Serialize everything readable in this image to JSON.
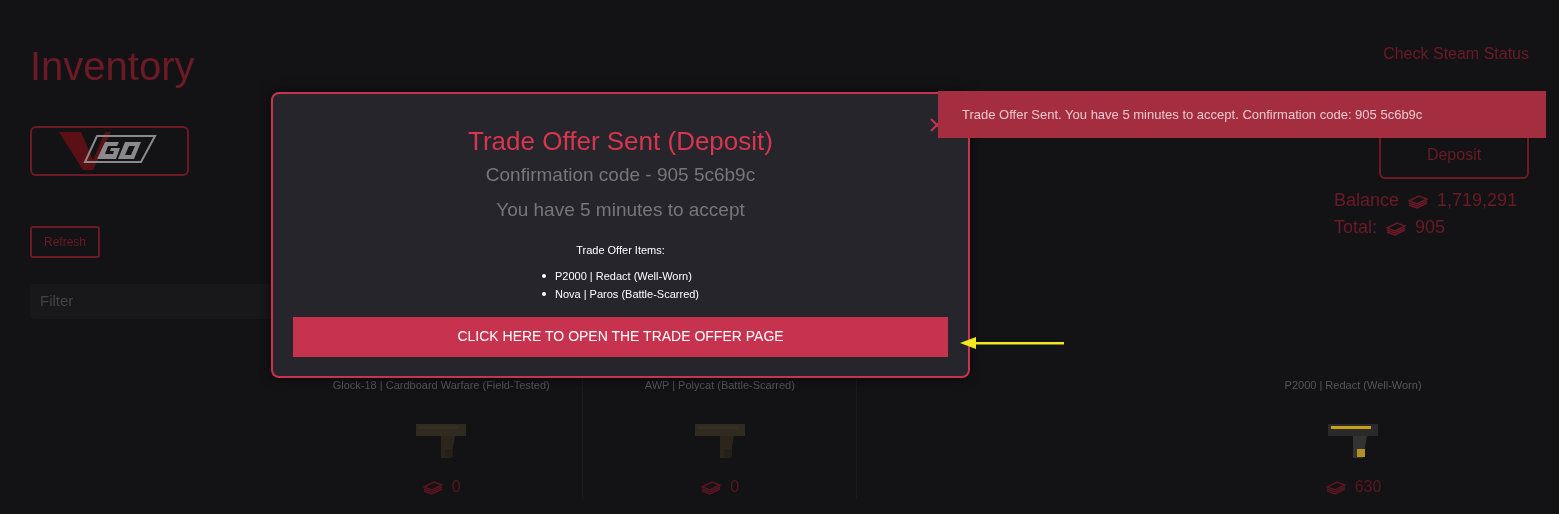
{
  "page": {
    "title": "Inventory",
    "steam_status_link": "Check Steam Status",
    "refresh_button": "Refresh",
    "filter": {
      "placeholder": "Filter"
    },
    "deposit_button": "Deposit",
    "balance": {
      "label": "Balance",
      "value": "1,719,291"
    },
    "total": {
      "label": "Total:",
      "value": "905"
    }
  },
  "items": [
    {
      "name": "Glock-18 | Cardboard Warfare (Field-Tested)",
      "price": "0"
    },
    {
      "name": "AWP | Polycat (Battle-Scarred)",
      "price": "0"
    },
    {
      "name": "P2000 | Redact (Well-Worn)",
      "price": "630"
    }
  ],
  "modal": {
    "title": "Trade Offer Sent (Deposit)",
    "code_line": "Confirmation code - 905 5c6b9c",
    "time_line": "You have 5 minutes to accept",
    "items_heading": "Trade Offer Items:",
    "items": [
      "P2000 | Redact (Well-Worn)",
      "Nova | Paros (Battle-Scarred)"
    ],
    "open_button": "CLICK HERE TO OPEN THE TRADE OFFER PAGE"
  },
  "toast": {
    "message": "Trade Offer Sent. You have 5 minutes to accept. Confirmation code: 905 5c6b9c"
  }
}
